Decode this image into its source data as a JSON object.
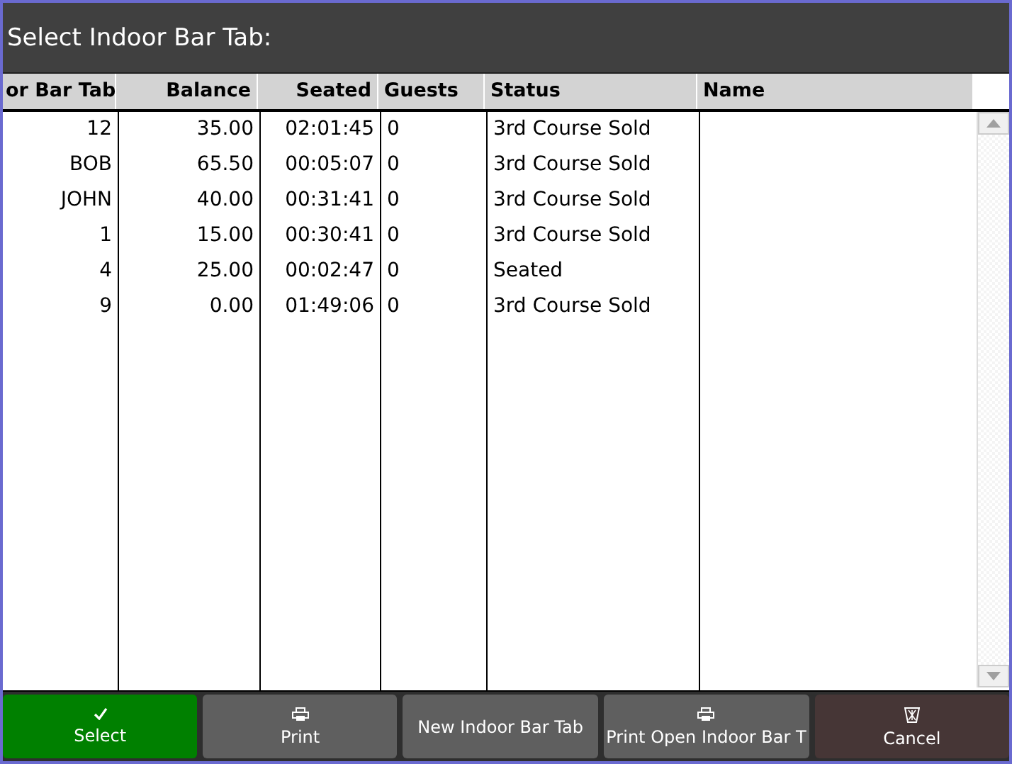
{
  "window": {
    "title": "Select Indoor Bar Tab:"
  },
  "table": {
    "columns": [
      "or Bar Tab",
      "Balance",
      "Seated",
      "Guests",
      "Status",
      "Name"
    ],
    "rows": [
      [
        "12",
        "35.00",
        "02:01:45",
        "0",
        "3rd Course Sold",
        ""
      ],
      [
        "BOB",
        "65.50",
        "00:05:07",
        "0",
        "3rd Course Sold",
        ""
      ],
      [
        "JOHN",
        "40.00",
        "00:31:41",
        "0",
        "3rd Course Sold",
        ""
      ],
      [
        "1",
        "15.00",
        "00:30:41",
        "0",
        "3rd Course Sold",
        ""
      ],
      [
        "4",
        "25.00",
        "00:02:47",
        "0",
        "Seated",
        ""
      ],
      [
        "9",
        "0.00",
        "01:49:06",
        "0",
        "3rd Course Sold",
        ""
      ]
    ]
  },
  "buttons": [
    {
      "label": "Select",
      "kind": "select"
    },
    {
      "label": "Print",
      "kind": "print"
    },
    {
      "label": "New Indoor Bar Tab",
      "kind": "plain"
    },
    {
      "label": "Print Open Indoor Bar T",
      "kind": "print"
    },
    {
      "label": "Cancel",
      "kind": "cancel"
    }
  ]
}
